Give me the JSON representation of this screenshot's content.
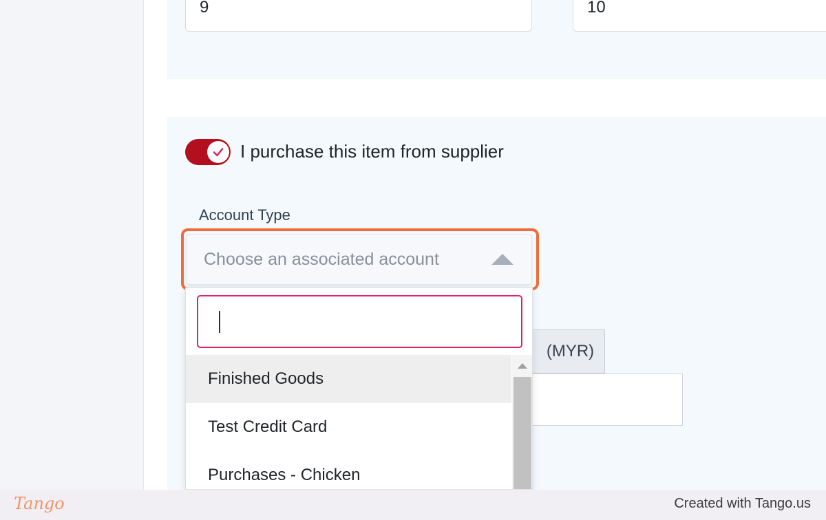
{
  "top_inputs": {
    "first_value": "9",
    "second_value": "10"
  },
  "purchase_toggle": {
    "label": "I purchase this item from supplier",
    "checked": true,
    "color": "#b30f1e"
  },
  "account_type": {
    "label": "Account Type",
    "placeholder": "Choose an associated account",
    "highlight_color": "#f26b3a"
  },
  "dropdown": {
    "search_value": "",
    "search_border_color": "#e0245e",
    "options": [
      "Finished Goods",
      "Test Credit Card",
      "Purchases - Chicken"
    ],
    "hovered_option": "Finished Goods"
  },
  "price": {
    "currency_label": "(MYR)",
    "value": ""
  },
  "footer": {
    "brand": "Tango",
    "credit": "Created with Tango.us"
  }
}
